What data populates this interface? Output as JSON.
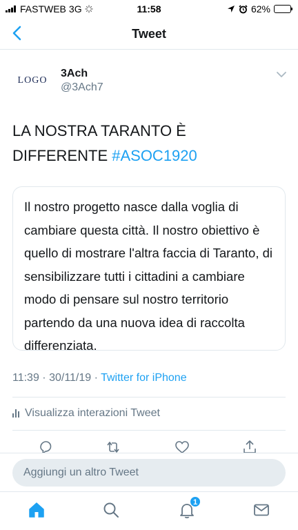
{
  "status_bar": {
    "carrier": "FASTWEB",
    "network": "3G",
    "time": "11:58",
    "battery": "62%",
    "battery_level": 0.62
  },
  "nav": {
    "title": "Tweet",
    "back_icon": "chevron-left-icon"
  },
  "tweet": {
    "avatar_text": "LOGO",
    "author_name": "3Ach",
    "author_handle": "@3Ach7",
    "text_main": "LA NOSTRA TARANTO È DIFFERENTE ",
    "hashtag": "#ASOC1920",
    "card_text": "Il nostro progetto nasce dalla voglia di cambiare questa città. Il nostro obiettivo è quello di mostrare l'altra faccia di Taranto, di sensibilizzare tutti i cittadini a cambiare modo di pensare sul nostro territorio partendo da una nuova idea di raccolta differenziata.",
    "timestamp": "11:39 · 30/11/19 · ",
    "source": "Twitter for iPhone",
    "engagements_label": "Visualizza interazioni Tweet"
  },
  "reply": {
    "placeholder": "Aggiungi un altro Tweet"
  },
  "tabbar": {
    "notification_count": "1"
  },
  "colors": {
    "accent": "#1da1f2",
    "secondary_text": "#657786",
    "border": "#e1e8ed"
  }
}
